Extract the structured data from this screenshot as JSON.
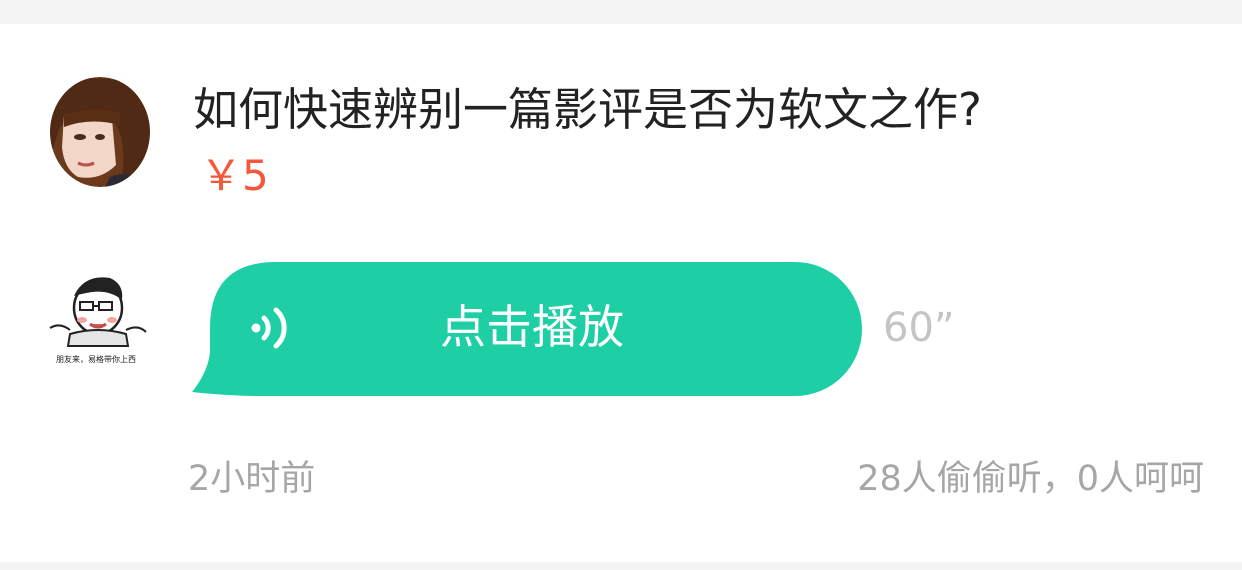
{
  "question": {
    "title": "如何快速辨别一篇影评是否为软文之作?",
    "price": "￥5"
  },
  "answer": {
    "play_label": "点击播放",
    "duration": "60”",
    "avatar_caption": "朋友来，易格带你上西"
  },
  "meta": {
    "time_ago": "2小时前",
    "stats": "28人偷偷听，0人呵呵"
  },
  "colors": {
    "accent_green": "#1ecfa5",
    "price_red": "#f4573a",
    "muted_gray": "#a6a6a6"
  },
  "icons": {
    "sound": "sound-wave-icon"
  }
}
